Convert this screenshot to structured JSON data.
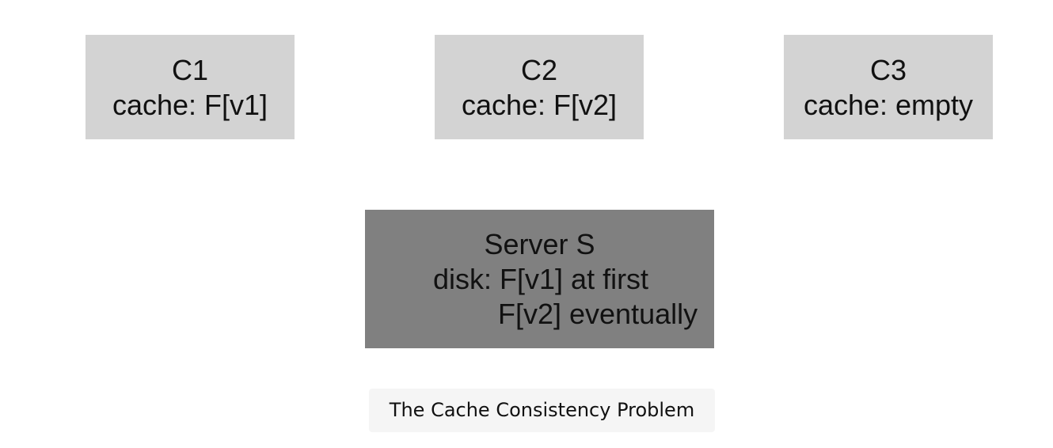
{
  "clients": [
    {
      "name": "C1",
      "cache": "cache: F[v1]"
    },
    {
      "name": "C2",
      "cache": "cache: F[v2]"
    },
    {
      "name": "C3",
      "cache": "cache: empty"
    }
  ],
  "server": {
    "name": "Server S",
    "disk_line1": "disk: F[v1] at first",
    "disk_line2": "F[v2] eventually"
  },
  "caption": "The Cache Consistency Problem",
  "colors": {
    "client_fill": "#d3d3d3",
    "server_fill": "#808080",
    "caption_fill": "#f5f5f5",
    "text": "#111111"
  }
}
